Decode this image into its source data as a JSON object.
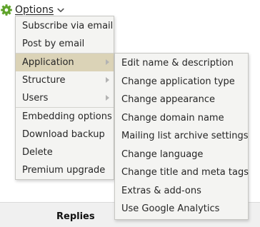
{
  "header": {
    "options_label": "Options"
  },
  "options_menu": {
    "items": [
      {
        "label": "Subscribe via email"
      },
      {
        "label": "Post by email"
      },
      {
        "label": "Application"
      },
      {
        "label": "Structure"
      },
      {
        "label": "Users"
      },
      {
        "label": "Embedding options"
      },
      {
        "label": "Download backup"
      },
      {
        "label": "Delete"
      },
      {
        "label": "Premium upgrade"
      }
    ],
    "active_item": "Application"
  },
  "application_submenu": {
    "items": [
      {
        "label": "Edit name & description"
      },
      {
        "label": "Change application type"
      },
      {
        "label": "Change appearance"
      },
      {
        "label": "Change domain name"
      },
      {
        "label": "Mailing list archive settings"
      },
      {
        "label": "Change language"
      },
      {
        "label": "Change title and meta tags"
      },
      {
        "label": "Extras & add-ons"
      },
      {
        "label": "Use Google Analytics"
      }
    ]
  },
  "footer": {
    "column_label": "Replies"
  },
  "icons": {
    "options": "gear-icon",
    "dropdown": "chevron-down-icon",
    "submenu": "chevron-right-icon"
  },
  "colors": {
    "gear": "#5fa32b",
    "menu_bg": "#f4f4f2",
    "active_bg": "#dbd3b7"
  }
}
